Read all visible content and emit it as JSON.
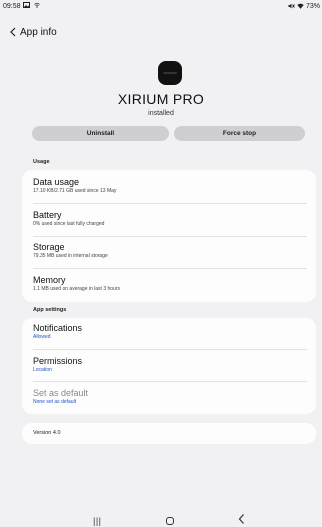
{
  "status_bar": {
    "time": "09:58",
    "left_icons": "▣ ₙ",
    "right_text": "✕ ▾ 73%"
  },
  "header": {
    "back_glyph": "<",
    "title": "App info"
  },
  "app": {
    "name": "XIRIUM PRO",
    "status": "installed"
  },
  "actions": {
    "uninstall_label": "Uninstall",
    "force_stop_label": "Force stop"
  },
  "usage": {
    "header": "Usage",
    "items": [
      {
        "title": "Data usage",
        "subtitle": "17.10 KB/2.71 GB used since 13 May"
      },
      {
        "title": "Battery",
        "subtitle": "0% used since last fully charged"
      },
      {
        "title": "Storage",
        "subtitle": "79.35 MB used in internal storage"
      },
      {
        "title": "Memory",
        "subtitle": "1.1 MB used on average in last 3 hours"
      }
    ]
  },
  "app_settings": {
    "header": "App settings",
    "items": [
      {
        "title": "Notifications",
        "subtitle": "Allowed"
      },
      {
        "title": "Permissions",
        "subtitle": "Location"
      },
      {
        "title": "Set as default",
        "subtitle": "None set as default"
      }
    ]
  },
  "version": {
    "label": "Version 4.0"
  },
  "nav": {
    "recents_glyph": "|||",
    "back_glyph": "<"
  },
  "colors": {
    "accent": "#1f55c8",
    "background": "#f1f1f3",
    "card": "#fdfdfd",
    "button": "#cfcfd2"
  }
}
